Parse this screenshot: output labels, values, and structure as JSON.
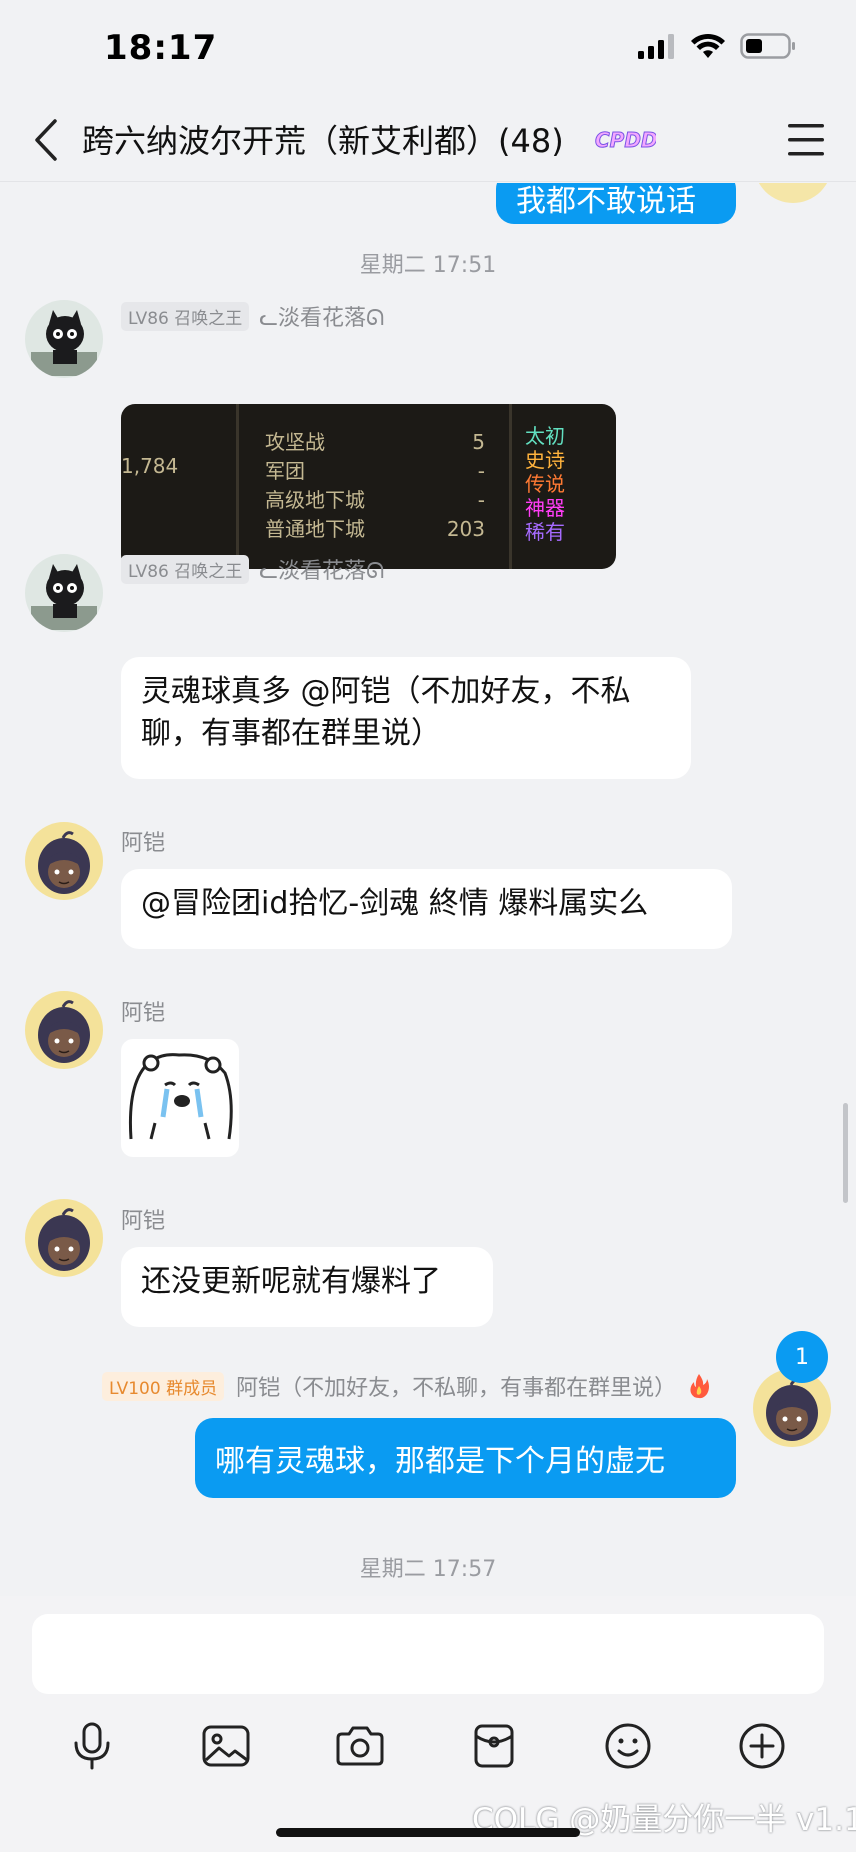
{
  "status_bar": {
    "time": "18:17"
  },
  "header": {
    "title": "跨六纳波尔开荒（新艾利都）(48)",
    "badge": "CPDD"
  },
  "messages": {
    "m1": {
      "text": "我都不敢说话"
    },
    "ts1": "星期二 17:51",
    "m2": {
      "level": "LV86 召唤之王",
      "name": "ᓚ淡看花落ᘏ",
      "image": {
        "left_value": "1,784",
        "rows": [
          {
            "label": "攻坚战",
            "value": "5"
          },
          {
            "label": "军团",
            "value": "-"
          },
          {
            "label": "高级地下城",
            "value": "-"
          },
          {
            "label": "普通地下城",
            "value": "203"
          }
        ],
        "rarities": [
          "太初",
          "史诗",
          "传说",
          "神器",
          "稀有"
        ]
      }
    },
    "m3": {
      "level": "LV86 召唤之王",
      "name": "ᓚ淡看花落ᘏ",
      "line1": "灵魂球真多 @阿铠（不加好友，不私",
      "line2": "聊，有事都在群里说）"
    },
    "m4": {
      "name": "阿铠",
      "text": "@冒险团id拾忆-剑魂 終情 爆料属实么"
    },
    "m5": {
      "name": "阿铠"
    },
    "m6": {
      "name": "阿铠",
      "text": "还没更新呢就有爆料了"
    },
    "m7": {
      "level": "LV100 群成员",
      "name": "阿铠（不加好友，不私聊，有事都在群里说）",
      "text": "哪有灵魂球，那都是下个月的虚无"
    },
    "ts2": "星期二 17:57"
  },
  "unread_count": "1",
  "watermark": "COLG @奶量分你一半 v1.1",
  "colors": {
    "accent": "#0a9bf2",
    "background": "#f1f2f4"
  },
  "toolbar_icons": [
    "microphone-icon",
    "image-icon",
    "camera-icon",
    "red-packet-icon",
    "emoji-icon",
    "plus-icon"
  ]
}
